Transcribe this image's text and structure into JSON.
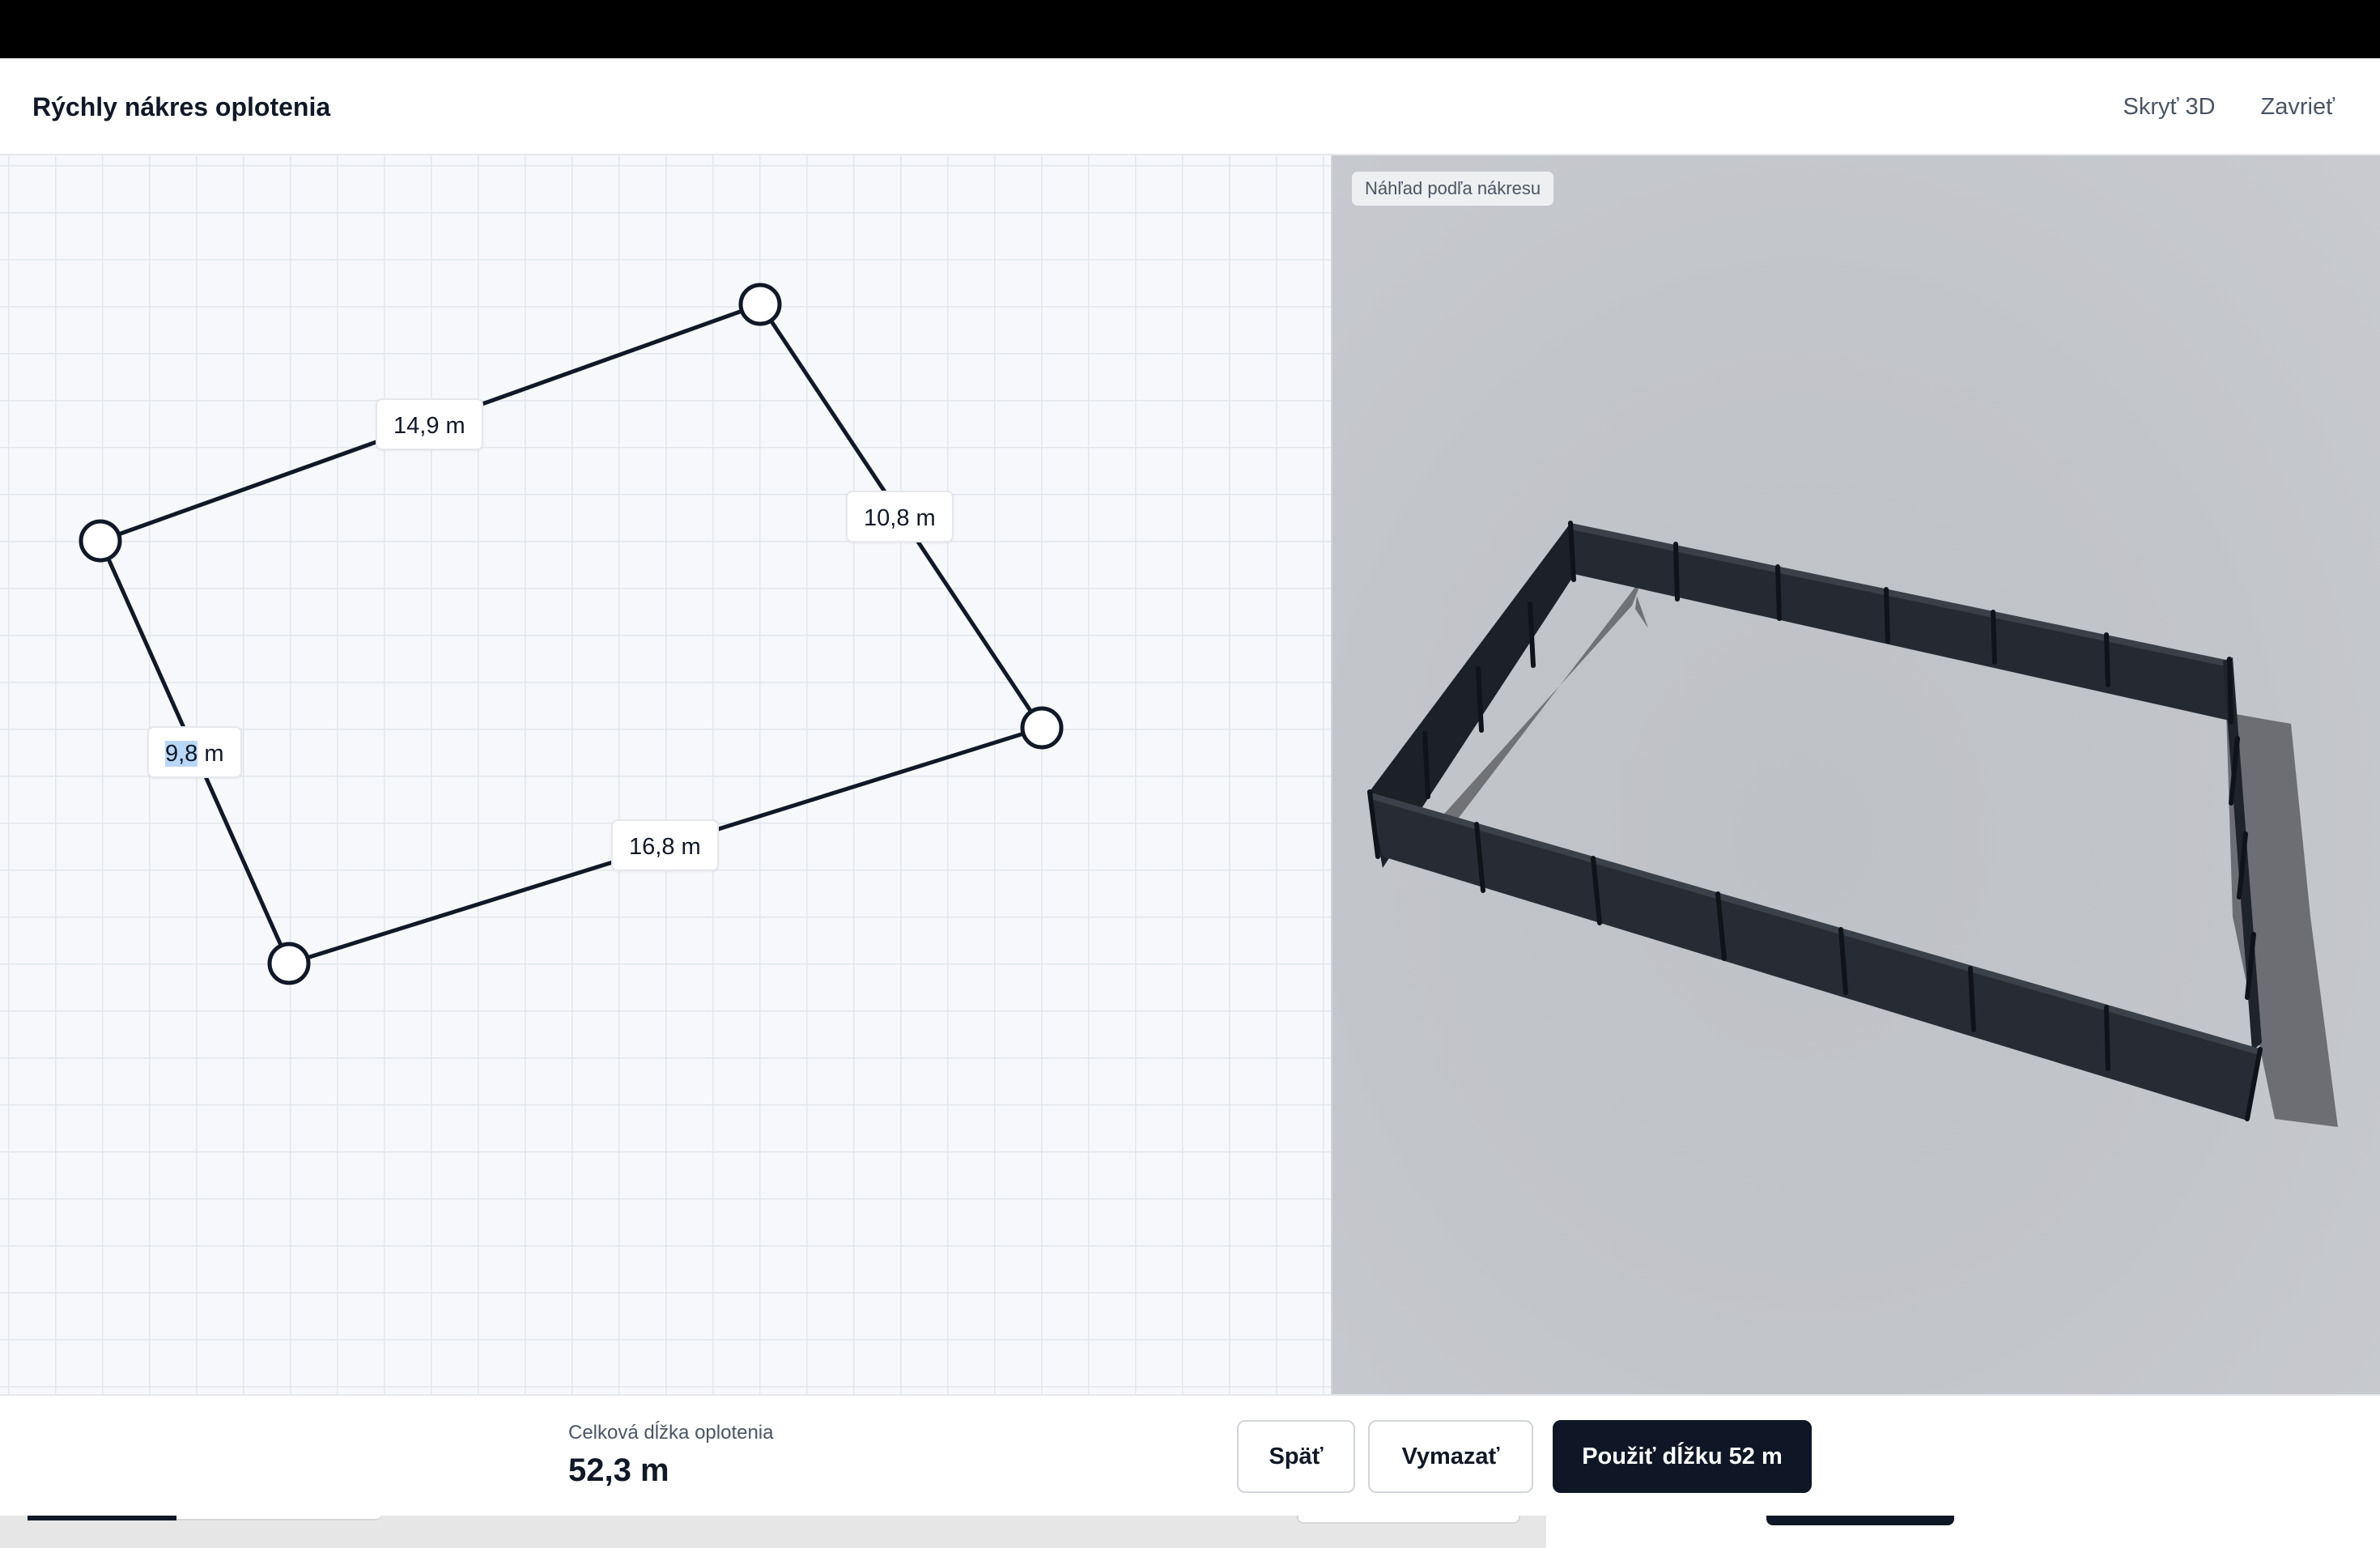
{
  "header": {
    "title": "Rýchly nákres oplotenia",
    "hide_3d_label": "Skryť 3D",
    "close_label": "Zavrieť"
  },
  "drawing": {
    "segments": [
      {
        "label_selected": "",
        "label_rest": "14,9 m"
      },
      {
        "label_selected": "",
        "label_rest": "10,8 m"
      },
      {
        "label_selected": "",
        "label_rest": "16,8 m"
      },
      {
        "label_selected": "9,8",
        "label_rest": " m"
      }
    ],
    "vertex_count": 4
  },
  "preview": {
    "badge": "Náhľad podľa nákresu"
  },
  "footer": {
    "total_label": "Celková dĺžka oplotenia",
    "total_value": "52,3 m",
    "back_label": "Späť",
    "clear_label": "Vymazať",
    "apply_label": "Použiť dĺžku 52 m"
  },
  "colors": {
    "line": "#111827",
    "primary_button": "#0f1726",
    "fence": "#20242b",
    "preview_ground": "#c2c5ca",
    "selection": "#b9d7f7"
  }
}
